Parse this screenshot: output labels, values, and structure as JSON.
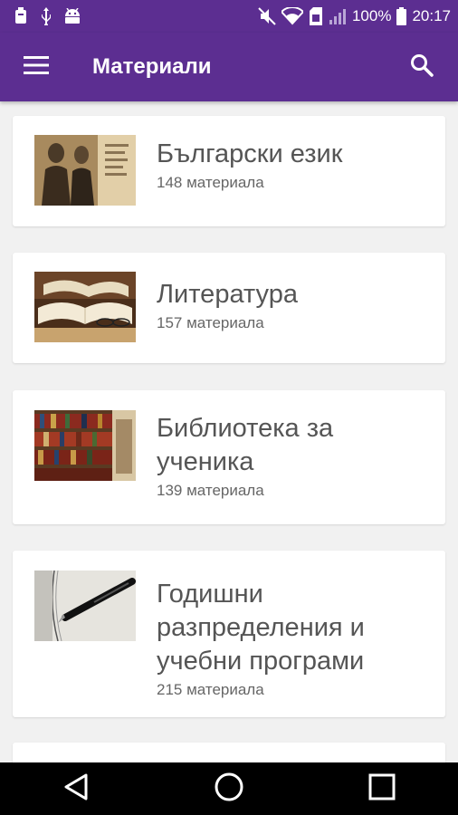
{
  "status_bar": {
    "battery_percent": "100%",
    "time": "20:17",
    "icons_left": [
      "storage-icon",
      "usb-icon",
      "android-icon"
    ],
    "icons_right": [
      "mute-icon",
      "wifi-icon",
      "sim-icon",
      "signal-icon",
      "battery-icon"
    ]
  },
  "app_bar": {
    "title": "Материали",
    "menu_icon": "hamburger-menu-icon",
    "search_icon": "search-icon",
    "color": "#5c2e91"
  },
  "categories": [
    {
      "title": "Български език",
      "count": "148 материала",
      "image": "old-photo-thumbnail"
    },
    {
      "title": "Литература",
      "count": "157 материала",
      "image": "open-books-thumbnail"
    },
    {
      "title": "Библиотека за ученика",
      "count": "139 материала",
      "image": "library-shelves-thumbnail"
    },
    {
      "title": "Годишни разпределения и учебни програми",
      "count": "215 материала",
      "image": "pen-notebook-thumbnail"
    }
  ],
  "nav_bar": {
    "back_icon": "back-triangle-icon",
    "home_icon": "home-circle-icon",
    "recents_icon": "recents-square-icon"
  }
}
